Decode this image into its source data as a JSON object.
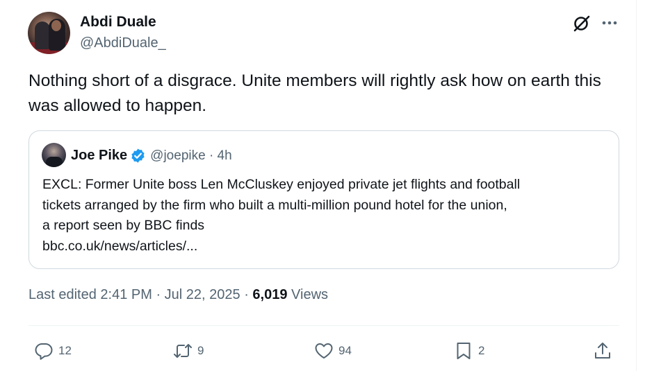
{
  "author": {
    "name": "Abdi Duale",
    "handle": "@AbdiDuale_"
  },
  "tweet": {
    "text": "Nothing short of a disgrace. Unite members will rightly ask how on earth this was allowed to happen."
  },
  "quoted": {
    "name": "Joe Pike",
    "meta": "@joepike · 4h",
    "text_line1": "EXCL: Former Unite boss Len McCluskey enjoyed private jet flights and football",
    "text_line2": "tickets arranged by the firm who built a multi-million pound hotel for the union,",
    "text_line3": "a report seen by BBC finds",
    "link": "bbc.co.uk/news/articles/..."
  },
  "meta": {
    "edited": "Last edited 2:41 PM · Jul 22, 2025 · ",
    "views_count": "6,019",
    "views_label": "Views"
  },
  "actions": {
    "replies": "12",
    "reposts": "9",
    "likes": "94",
    "bookmarks": "2"
  },
  "icons": {
    "grok": "grok-icon",
    "more": "more-icon",
    "verified": "verified-badge-icon",
    "reply": "reply-icon",
    "repost": "repost-icon",
    "like": "like-icon",
    "bookmark": "bookmark-icon",
    "share": "share-icon"
  },
  "colors": {
    "text": "#0f1419",
    "secondary": "#536471",
    "verified": "#1d9bf0",
    "border": "#cfd9de"
  }
}
